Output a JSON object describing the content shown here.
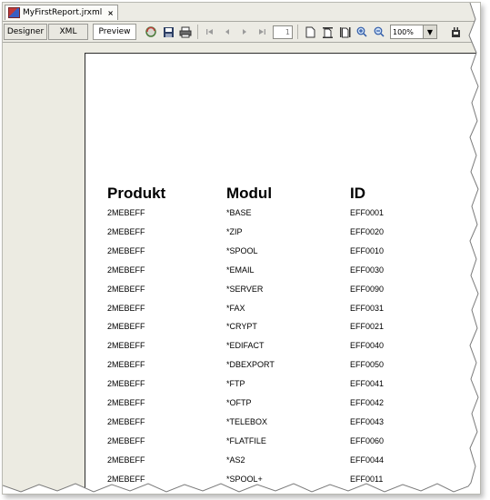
{
  "window": {
    "file_tab_label": "MyFirstReport.jrxml",
    "close_glyph": "×"
  },
  "view_tabs": [
    "Designer",
    "XML",
    "Preview"
  ],
  "active_view": "Preview",
  "toolbar": {
    "icons": [
      "reload-icon",
      "save-icon",
      "print-icon",
      "first-page-icon",
      "previous-page-icon",
      "next-page-icon",
      "last-page-icon",
      "actual-size-icon",
      "fit-page-icon",
      "fit-width-icon",
      "zoom-in-icon",
      "zoom-out-icon",
      "export-icon"
    ],
    "page_value": "1",
    "zoom_value": "100%"
  },
  "report": {
    "headers": {
      "produkt": "Produkt",
      "modul": "Modul",
      "id": "ID"
    },
    "rows": [
      {
        "produkt": "2MEBEFF",
        "modul": "*BASE",
        "id": "EFF0001"
      },
      {
        "produkt": "2MEBEFF",
        "modul": "*ZIP",
        "id": "EFF0020"
      },
      {
        "produkt": "2MEBEFF",
        "modul": "*SPOOL",
        "id": "EFF0010"
      },
      {
        "produkt": "2MEBEFF",
        "modul": "*EMAIL",
        "id": "EFF0030"
      },
      {
        "produkt": "2MEBEFF",
        "modul": "*SERVER",
        "id": "EFF0090"
      },
      {
        "produkt": "2MEBEFF",
        "modul": "*FAX",
        "id": "EFF0031"
      },
      {
        "produkt": "2MEBEFF",
        "modul": "*CRYPT",
        "id": "EFF0021"
      },
      {
        "produkt": "2MEBEFF",
        "modul": "*EDIFACT",
        "id": "EFF0040"
      },
      {
        "produkt": "2MEBEFF",
        "modul": "*DBEXPORT",
        "id": "EFF0050"
      },
      {
        "produkt": "2MEBEFF",
        "modul": "*FTP",
        "id": "EFF0041"
      },
      {
        "produkt": "2MEBEFF",
        "modul": "*OFTP",
        "id": "EFF0042"
      },
      {
        "produkt": "2MEBEFF",
        "modul": "*TELEBOX",
        "id": "EFF0043"
      },
      {
        "produkt": "2MEBEFF",
        "modul": "*FLATFILE",
        "id": "EFF0060"
      },
      {
        "produkt": "2MEBEFF",
        "modul": "*AS2",
        "id": "EFF0044"
      },
      {
        "produkt": "2MEBEFF",
        "modul": "*SPOOL+",
        "id": "EFF0011"
      }
    ]
  },
  "colors": {
    "chrome": "#ecebe4",
    "preview_bg": "#ecebe2",
    "page": "#ffffff"
  }
}
